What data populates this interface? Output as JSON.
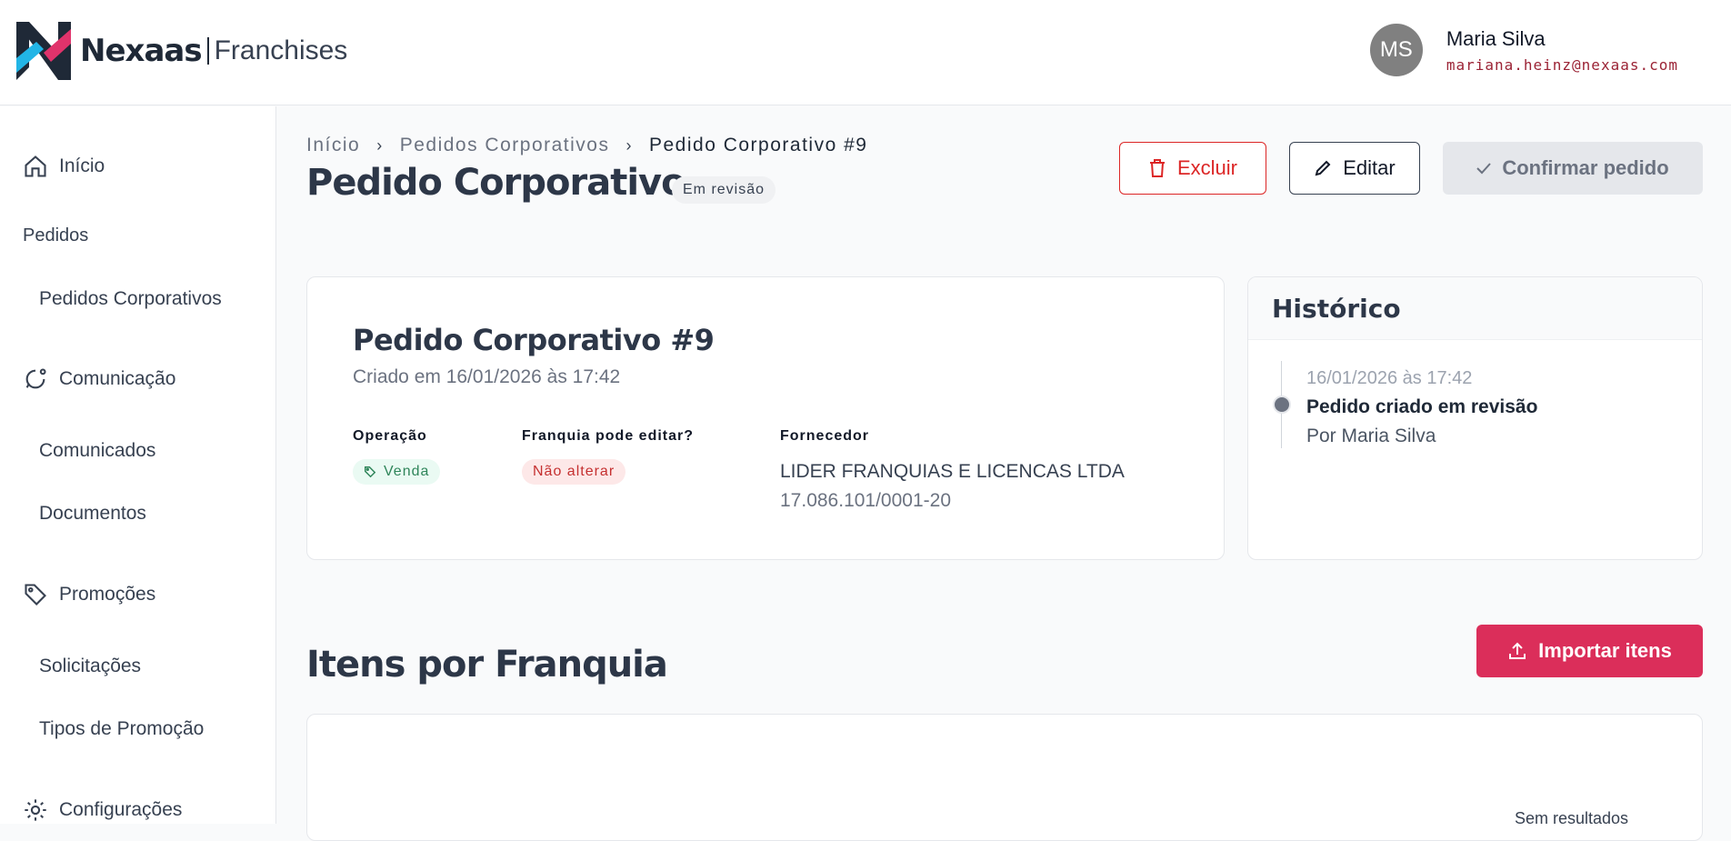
{
  "brand": {
    "name": "Nexaas",
    "sub": "Franchises"
  },
  "user": {
    "initials": "MS",
    "name": "Maria Silva",
    "email": "mariana.heinz@nexaas.com"
  },
  "sidebar": {
    "inicio": "Início",
    "pedidos_heading": "Pedidos",
    "pedidos_corporativos": "Pedidos Corporativos",
    "comunicacao": "Comunicação",
    "comunicados": "Comunicados",
    "documentos": "Documentos",
    "promocoes": "Promoções",
    "solicitacoes": "Solicitações",
    "tipos_promocao": "Tipos de Promoção",
    "configuracoes": "Configurações"
  },
  "breadcrumb": [
    "Início",
    "Pedidos Corporativos",
    "Pedido Corporativo #9"
  ],
  "page": {
    "title": "Pedido Corporativo",
    "status": "Em revisão"
  },
  "actions": {
    "delete": "Excluir",
    "edit": "Editar",
    "confirm": "Confirmar pedido"
  },
  "order": {
    "title": "Pedido Corporativo #9",
    "created": "Criado em 16/01/2026 às 17:42",
    "operation_label": "Operação",
    "operation_value": "Venda",
    "can_edit_label": "Franquia pode editar?",
    "can_edit_value": "Não alterar",
    "supplier_label": "Fornecedor",
    "supplier_name": "LIDER FRANQUIAS E LICENCAS LTDA",
    "supplier_cnpj": "17.086.101/0001-20"
  },
  "history": {
    "title": "Histórico",
    "entries": [
      {
        "date": "16/01/2026 às 17:42",
        "event": "Pedido criado em revisão",
        "by": "Por Maria Silva"
      }
    ]
  },
  "items": {
    "title": "Itens por Franquia",
    "import_label": "Importar itens",
    "empty": "Sem resultados"
  },
  "colors": {
    "accent": "#db2e5a",
    "danger": "#dc2626",
    "success": "#2f855a"
  }
}
